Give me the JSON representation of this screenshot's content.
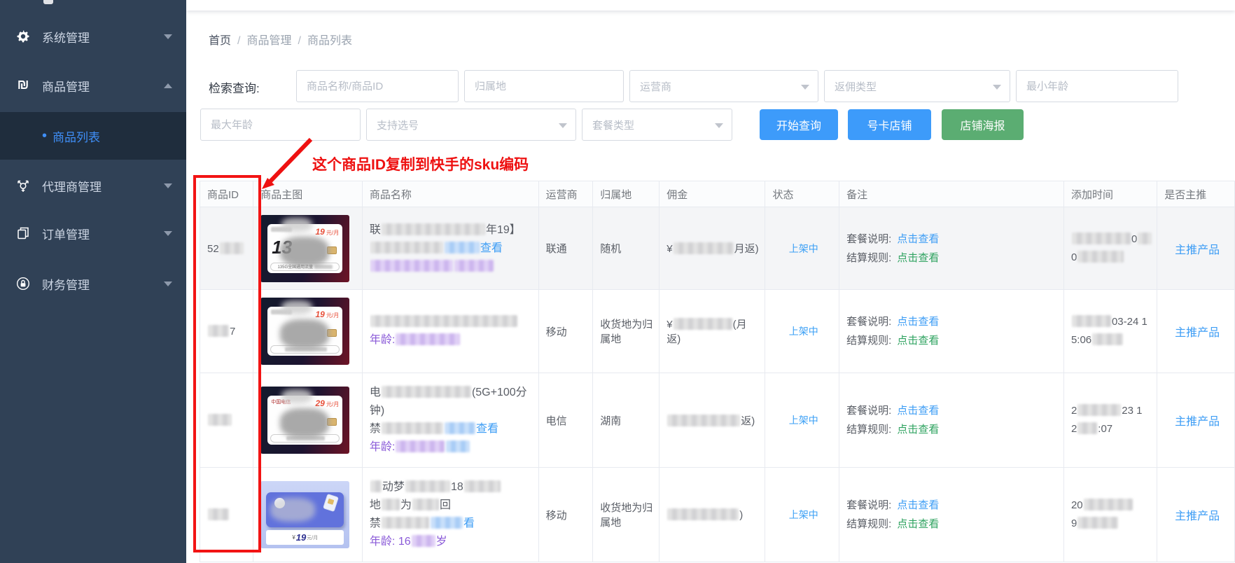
{
  "colors": {
    "sidebar_bg": "#304156",
    "submenu_bg": "#1f2d3d",
    "accent_blue": "#3d9df5",
    "link_green": "#2fa360",
    "button_blue": "#3d9bfa",
    "button_green": "#5bad72",
    "annotation_red": "#ee1111",
    "purple_text": "#8a5ad8",
    "status_blue": "#3a9ff5"
  },
  "sidebar": {
    "items": [
      {
        "label": "系统管理",
        "icon": "gear-icon",
        "chevron": "down"
      },
      {
        "label": "商品管理",
        "icon": "product-icon",
        "chevron": "up",
        "children": [
          {
            "label": "商品列表",
            "active": true,
            "bullet": "•"
          }
        ]
      },
      {
        "label": "代理商管理",
        "icon": "agent-icon",
        "chevron": "down"
      },
      {
        "label": "订单管理",
        "icon": "order-icon",
        "chevron": "down"
      },
      {
        "label": "财务管理",
        "icon": "finance-icon",
        "chevron": "down"
      }
    ]
  },
  "breadcrumb": {
    "items": [
      "首页",
      "商品管理",
      "商品列表"
    ],
    "separator": "/"
  },
  "filters": {
    "label": "检索查询:",
    "row1": [
      {
        "name": "product-name-input",
        "type": "input",
        "placeholder": "商品名称/商品ID"
      },
      {
        "name": "region-input",
        "type": "input",
        "placeholder": "归属地"
      },
      {
        "name": "carrier-select",
        "type": "select",
        "placeholder": "运营商"
      },
      {
        "name": "rebate-type-select",
        "type": "select",
        "placeholder": "返佣类型"
      },
      {
        "name": "min-age-input",
        "type": "input",
        "placeholder": "最小年龄"
      }
    ],
    "row2": [
      {
        "name": "max-age-input",
        "type": "input",
        "placeholder": "最大年龄"
      },
      {
        "name": "number-pick-select",
        "type": "select",
        "placeholder": "支持选号"
      },
      {
        "name": "package-type-select",
        "type": "select",
        "placeholder": "套餐类型"
      }
    ],
    "buttons": [
      {
        "name": "query-button",
        "label": "开始查询",
        "color": "blue"
      },
      {
        "name": "card-shop-button",
        "label": "号卡店铺",
        "color": "blue"
      },
      {
        "name": "shop-poster-button",
        "label": "店铺海报",
        "color": "green"
      }
    ]
  },
  "annotation": {
    "text": "这个商品ID复制到快手的sku编码"
  },
  "table": {
    "headers": [
      "商品ID",
      "商品主图",
      "商品名称",
      "运营商",
      "归属地",
      "佣金",
      "状态",
      "备注",
      "添加时间",
      "是否主推"
    ],
    "remark": {
      "line1_label": "套餐说明:",
      "line2_label": "结算规则:",
      "link": "点击查看"
    },
    "rows": [
      {
        "id": [
          {
            "t": "52"
          },
          {
            "b": 34
          }
        ],
        "image": {
          "kind": "dark",
          "brand_blur": true,
          "price": "19",
          "unit": "元/月",
          "big": "13",
          "pill": "135G全国通用流量",
          "pill_blur": 26
        },
        "name": [
          [
            {
              "t": "联"
            },
            {
              "b": 148
            },
            {
              "t": "年19】"
            }
          ],
          [
            {
              "b": 104
            },
            {
              "b": 50,
              "c": "bb"
            },
            {
              "t": "查看",
              "c": "link"
            }
          ],
          [
            {
              "b": 118,
              "c": "pb"
            },
            {
              "b": 56,
              "c": "pb"
            }
          ]
        ],
        "carrier": "联通",
        "region": "随机",
        "commission": [
          {
            "t": "¥"
          },
          {
            "b": 86
          },
          {
            "t": "月返)"
          }
        ],
        "status": "上架中",
        "time": [
          [
            {
              "b": 84
            },
            {
              "t": "0"
            },
            {
              "b": 20
            }
          ],
          [
            {
              "t": "0"
            },
            {
              "b": 66
            }
          ]
        ],
        "main": "主推产品",
        "hover": true
      },
      {
        "id": [
          {
            "b": 30
          },
          {
            "t": "7"
          }
        ],
        "image": {
          "kind": "dark",
          "brand_blur": true,
          "price": "19",
          "unit": "元/月",
          "big": "",
          "pill": "",
          "pill_blur": 60
        },
        "name": [
          [
            {
              "b": 210
            }
          ],
          [
            {
              "t": "年龄:",
              "c": "purple"
            },
            {
              "b": 92,
              "c": "pb"
            }
          ]
        ],
        "carrier": "移动",
        "region": "收货地为归属地",
        "commission": [
          {
            "t": "¥"
          },
          {
            "b": 84
          },
          {
            "t": "(月返)"
          }
        ],
        "status": "上架中",
        "time": [
          [
            {
              "b": 56
            },
            {
              "t": "03-24 1"
            }
          ],
          [
            {
              "t": "5:06"
            },
            {
              "b": 44
            }
          ]
        ],
        "main": "主推产品",
        "hover": false
      },
      {
        "id": [
          {
            "b": 34
          }
        ],
        "image": {
          "kind": "telecom",
          "brand": "中国电信",
          "price": "29",
          "unit": "元/月",
          "pill": "",
          "pill_blur": 55
        },
        "name": [
          [
            {
              "t": "电"
            },
            {
              "b": 128
            },
            {
              "t": "(5G+100分"
            }
          ],
          [
            {
              "t": "钟)"
            }
          ],
          [
            {
              "t": "禁"
            },
            {
              "b": 88
            },
            {
              "b": 44,
              "c": "bb"
            },
            {
              "t": "查看",
              "c": "link"
            }
          ],
          [
            {
              "t": "年龄:",
              "c": "purple"
            },
            {
              "b": 70,
              "c": "pb"
            },
            {
              "b": 34,
              "c": "bb"
            }
          ]
        ],
        "carrier": "电信",
        "region": "湖南",
        "commission": [
          {
            "b": 104
          },
          {
            "t": "返)"
          }
        ],
        "status": "上架中",
        "time": [
          [
            {
              "t": "2"
            },
            {
              "b": 62
            },
            {
              "t": "23 1"
            }
          ],
          [
            {
              "t": "2"
            },
            {
              "b": 28
            },
            {
              "t": ":07"
            }
          ]
        ],
        "main": "主推产品",
        "hover": false
      },
      {
        "id": [
          {
            "b": 30
          }
        ],
        "image": {
          "kind": "blue",
          "price": "¥",
          "big": "19",
          "unit": "元/月"
        },
        "name": [
          [
            {
              "b": 16
            },
            {
              "t": "动梦"
            },
            {
              "b": 64
            },
            {
              "t": "18"
            },
            {
              "b": 52
            }
          ],
          [
            {
              "t": "地"
            },
            {
              "b": 26
            },
            {
              "t": "为"
            },
            {
              "b": 38
            },
            {
              "t": "回"
            }
          ],
          [
            {
              "t": "禁"
            },
            {
              "b": 68
            },
            {
              "b": 46,
              "c": "bb"
            },
            {
              "t": "看",
              "c": "link"
            }
          ],
          [
            {
              "t": "年龄: 16",
              "c": "purple"
            },
            {
              "b": 34,
              "c": "pb"
            },
            {
              "t": "岁",
              "c": "purple"
            }
          ]
        ],
        "carrier": "移动",
        "region": "收货地为归属地",
        "commission": [
          {
            "b": 102
          },
          {
            "t": ")"
          }
        ],
        "status": "上架中",
        "time": [
          [
            {
              "t": "20"
            },
            {
              "b": 70
            }
          ],
          [
            {
              "t": "9"
            },
            {
              "b": 58
            }
          ]
        ],
        "main": "主推产品",
        "hover": false
      }
    ]
  }
}
